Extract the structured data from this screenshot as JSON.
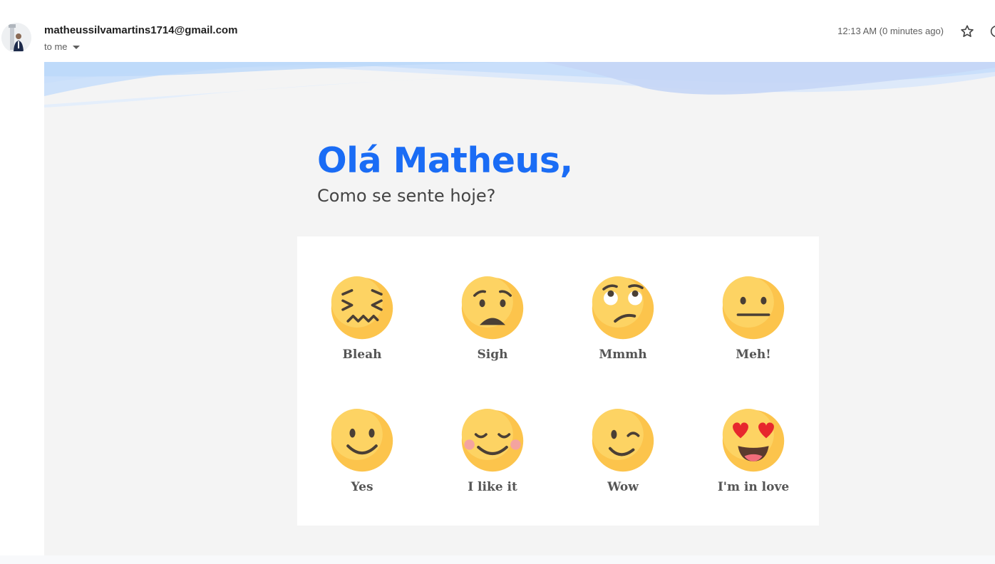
{
  "header": {
    "sender": "matheussilvamartins1714@gmail.com",
    "recipient": "to me",
    "timestamp": "12:13 AM (0 minutes ago)",
    "icons": {
      "star": "star-icon",
      "caret": "chevron-down-icon",
      "more": "more-icon"
    }
  },
  "email": {
    "greeting": "Olá Matheus,",
    "subtitle": "Como se sente hoje?",
    "colors": {
      "greeting": "#1a6cf5",
      "background": "#f4f4f4",
      "emoji": "#fcc44c"
    },
    "moods": [
      {
        "label": "Bleah",
        "icon": "confounded-face-icon"
      },
      {
        "label": "Sigh",
        "icon": "worried-face-icon"
      },
      {
        "label": "Mmmh",
        "icon": "eye-roll-face-icon"
      },
      {
        "label": "Meh!",
        "icon": "neutral-face-icon"
      },
      {
        "label": "Yes",
        "icon": "smiling-face-icon"
      },
      {
        "label": "I like it",
        "icon": "blushing-face-icon"
      },
      {
        "label": "Wow",
        "icon": "winking-face-icon"
      },
      {
        "label": "I'm in love",
        "icon": "heart-eyes-face-icon"
      }
    ]
  }
}
